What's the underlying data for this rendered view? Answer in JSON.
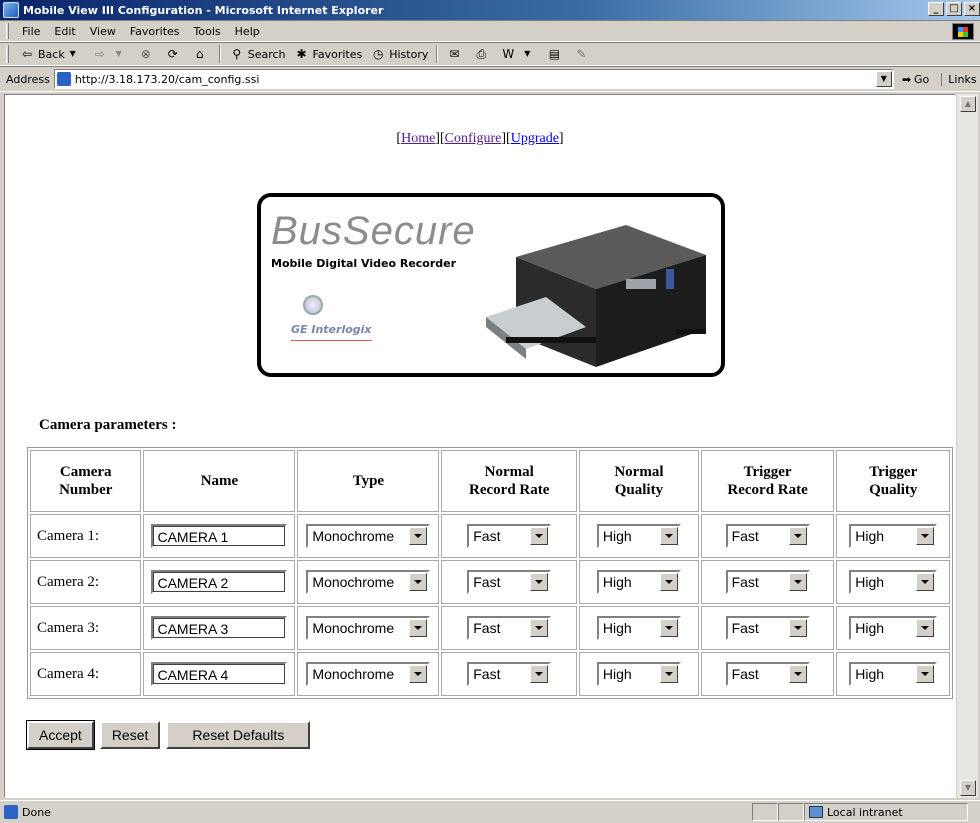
{
  "window": {
    "title": "Mobile View III Configuration - Microsoft Internet Explorer",
    "buttons": [
      "_",
      "□",
      "×"
    ]
  },
  "menu": [
    "File",
    "Edit",
    "View",
    "Favorites",
    "Tools",
    "Help"
  ],
  "toolbar": {
    "back": "Back",
    "search": "Search",
    "favorites": "Favorites",
    "history": "History"
  },
  "address": {
    "label": "Address",
    "url": "http://3.18.173.20/cam_config.ssi",
    "go": "Go",
    "links": "Links"
  },
  "nav": {
    "open": "[",
    "home": "Home",
    "configure": "Configure",
    "upgrade": "Upgrade",
    "sep": "][",
    "close": "]"
  },
  "banner": {
    "brand": "BusSecure",
    "subtitle": "Mobile Digital Video Recorder",
    "company": "GE Interlogix"
  },
  "section_label": "Camera parameters :",
  "table": {
    "headers": [
      [
        "Camera",
        "Number"
      ],
      [
        "Name",
        ""
      ],
      [
        "Type",
        ""
      ],
      [
        "Normal",
        "Record Rate"
      ],
      [
        "Normal",
        "Quality"
      ],
      [
        "Trigger",
        "Record Rate"
      ],
      [
        "Trigger",
        "Quality"
      ]
    ],
    "rows": [
      {
        "camera": "Camera 1:",
        "name": "CAMERA 1",
        "type": "Monochrome",
        "normal_rate": "Fast",
        "normal_quality": "High",
        "trigger_rate": "Fast",
        "trigger_quality": "High"
      },
      {
        "camera": "Camera 2:",
        "name": "CAMERA 2",
        "type": "Monochrome",
        "normal_rate": "Fast",
        "normal_quality": "High",
        "trigger_rate": "Fast",
        "trigger_quality": "High"
      },
      {
        "camera": "Camera 3:",
        "name": "CAMERA 3",
        "type": "Monochrome",
        "normal_rate": "Fast",
        "normal_quality": "High",
        "trigger_rate": "Fast",
        "trigger_quality": "High"
      },
      {
        "camera": "Camera 4:",
        "name": "CAMERA 4",
        "type": "Monochrome",
        "normal_rate": "Fast",
        "normal_quality": "High",
        "trigger_rate": "Fast",
        "trigger_quality": "High"
      }
    ]
  },
  "buttons": {
    "accept": "Accept",
    "reset": "Reset",
    "reset_defaults": "Reset Defaults"
  },
  "status": {
    "text": "Done",
    "zone": "Local intranet"
  }
}
